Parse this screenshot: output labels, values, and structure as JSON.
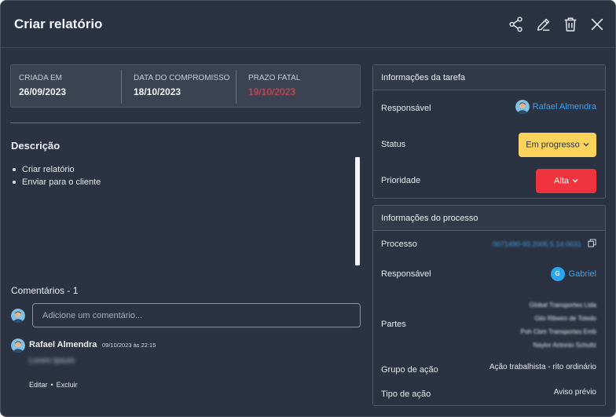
{
  "header": {
    "title": "Criar relatório",
    "icons": [
      "share-icon",
      "edit-icon",
      "trash-icon",
      "close-icon"
    ]
  },
  "dates": [
    {
      "label": "CRIADA EM",
      "value": "26/09/2023"
    },
    {
      "label": "DATA DO COMPROMISSO",
      "value": "18/10/2023"
    },
    {
      "label": "PRAZO FATAL",
      "value": "19/10/2023"
    }
  ],
  "description": {
    "title": "Descrição",
    "items": [
      "Criar relatório",
      "Enviar para o cliente"
    ]
  },
  "comments": {
    "title": "Comentários - 1",
    "input_placeholder": "Adicione um comentário...",
    "list": [
      {
        "author": "Rafael Almendra",
        "date": "09/10/2023 às 22:15",
        "body": "Lorem Ipsum",
        "edit_label": "Editar",
        "delete_label": "Excluir"
      }
    ]
  },
  "task_info": {
    "title": "Informações da tarefa",
    "responsible_label": "Responsável",
    "responsible": "Rafael Almendra",
    "status_label": "Status",
    "status": "Em progresso",
    "priority_label": "Prioridade",
    "priority": "Alta"
  },
  "process_info": {
    "title": "Informações do processo",
    "process_label": "Processo",
    "process_number": "0071490-93.2005.5.14.0031",
    "responsible_label": "Responsável",
    "responsible_initial": "G",
    "responsible": "Gabriel",
    "parties_label": "Partes",
    "parties": [
      "Global Transportes Ltda",
      "Gilo Ribeiro de Toledo",
      "Poh Cbm Transportes Emb",
      "Naylor Antonio Schultz"
    ],
    "action_group_label": "Grupo de ação",
    "action_group": "Ação trabalhista - rito ordinário",
    "action_type_label": "Tipo de ação",
    "action_type": "Aviso prévio"
  },
  "colors": {
    "background": "#2b3242",
    "card": "#3b4252",
    "link": "#3ea3e8",
    "deadline": "#ff4d55",
    "status": "#fdd45b",
    "priority": "#f0343d"
  }
}
